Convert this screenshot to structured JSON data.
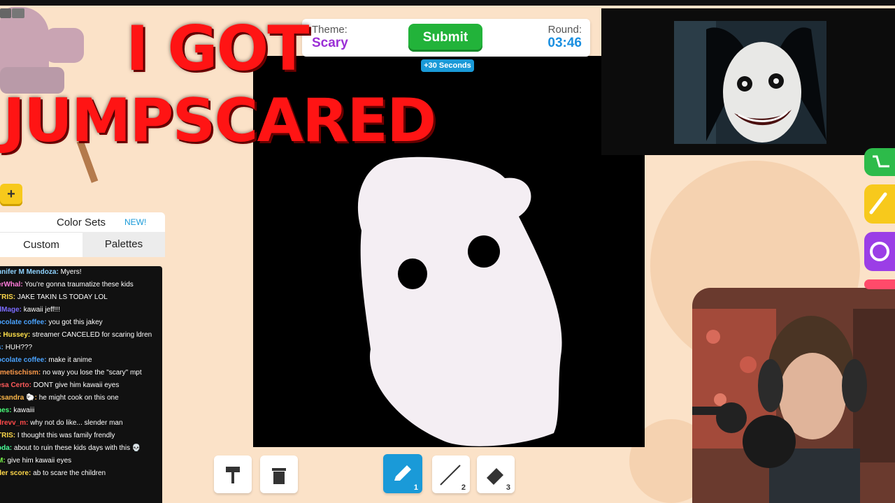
{
  "overlay": {
    "title_line1": "I GOT",
    "title_line2": "JUMPSCARED"
  },
  "header": {
    "theme_label": "Theme:",
    "theme_value": "Scary",
    "submit_label": "Submit",
    "round_label": "Round:",
    "round_time": "03:46",
    "bonus_label": "+30 Seconds"
  },
  "color_sets": {
    "title": "Color Sets",
    "new_badge": "NEW!",
    "tabs": [
      "Custom",
      "Palettes"
    ],
    "add_label": "+"
  },
  "chat": [
    {
      "name": "nnifer M Mendoza:",
      "text": "Myers!",
      "color": "#8fd3ff"
    },
    {
      "name": "erWhal:",
      "text": "You're gonna traumatize these kids",
      "color": "#ff7ad9"
    },
    {
      "name": "TRIS:",
      "text": "JAKE TAKIN LS TODAY LOL",
      "color": "#ffd84a"
    },
    {
      "name": "dMage:",
      "text": "kawaii jeff!!!",
      "color": "#7b6cff"
    },
    {
      "name": "ocolate coffee:",
      "text": "you got this jakey",
      "color": "#4aa3ff"
    },
    {
      "name": "x Hussey:",
      "text": "streamer CANCELED for scaring ldren",
      "color": "#ffe14a"
    },
    {
      "name": "s:",
      "text": "HUH???",
      "color": "#4aa3ff"
    },
    {
      "name": "ocolate coffee:",
      "text": "make it anime",
      "color": "#4aa3ff"
    },
    {
      "name": "rmetischism:",
      "text": "no way you lose the \"scary\" mpt",
      "color": "#ff9a4a"
    },
    {
      "name": "esa Certo:",
      "text": "DONT give him kawaii eyes",
      "color": "#ff5a5a"
    },
    {
      "name": "ksandra 🐑:",
      "text": "he might cook on this one",
      "color": "#ffb84a"
    },
    {
      "name": "nes:",
      "text": "kawaiii",
      "color": "#4aff7a"
    },
    {
      "name": "drevv_m:",
      "text": "why not do like... slender man",
      "color": "#ff4a4a"
    },
    {
      "name": "TRIS:",
      "text": "I thought this was family frendly",
      "color": "#ffd84a"
    },
    {
      "name": "oda:",
      "text": "about to ruin these kids days with this 💀",
      "color": "#4aff9a"
    },
    {
      "name": "M:",
      "text": "give him kawaii eyes",
      "color": "#7bff4a"
    },
    {
      "name": "der score:",
      "text": "ab to scare the children",
      "color": "#ffd84a"
    }
  ],
  "tools": {
    "pencil_num": "1",
    "line_num": "2",
    "eraser_num": "3"
  },
  "colors": {
    "submit": "#22b33a",
    "theme": "#9b2fd6",
    "round": "#1a8fe0",
    "title": "#ff1414"
  }
}
